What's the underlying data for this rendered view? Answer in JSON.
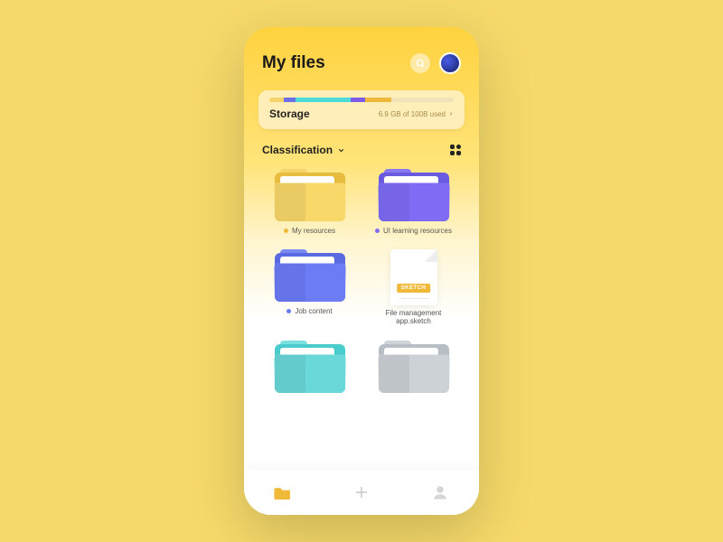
{
  "header": {
    "title": "My files"
  },
  "storage": {
    "label": "Storage",
    "usage": "6.9 GB of 100B used",
    "segments": [
      {
        "color": "#f6d36a",
        "pct": 8
      },
      {
        "color": "#6c6fe8",
        "pct": 6
      },
      {
        "color": "#4bd9d9",
        "pct": 30
      },
      {
        "color": "#7c5ce8",
        "pct": 8
      },
      {
        "color": "#f0b93a",
        "pct": 14
      }
    ]
  },
  "classification": {
    "label": "Classification"
  },
  "items": [
    {
      "type": "folder",
      "name": "My resources",
      "tab": "#f6d36a",
      "back": "#e8bc3e",
      "front": "#f9d86a",
      "dot": "#f0b93a"
    },
    {
      "type": "folder",
      "name": "UI learning resources",
      "tab": "#8a78f0",
      "back": "#6a5ae0",
      "front": "#7e6cf5",
      "dot": "#7e6cf5"
    },
    {
      "type": "folder",
      "name": "Job content",
      "tab": "#7a8af0",
      "back": "#5a6ae0",
      "front": "#6c7cf5",
      "dot": "#6c7cf5"
    },
    {
      "type": "file",
      "name": "File management app.sketch",
      "badge": "SKETCH"
    },
    {
      "type": "folder",
      "name": "",
      "tab": "#7de0e0",
      "back": "#4acccc",
      "front": "#6ad8d8",
      "dot": "#6ad8d8"
    },
    {
      "type": "folder",
      "name": "",
      "tab": "#d0d4d8",
      "back": "#b8bec5",
      "front": "#cdd2d7",
      "dot": "#cdd2d7"
    }
  ],
  "tabbar": {
    "active": 0
  }
}
